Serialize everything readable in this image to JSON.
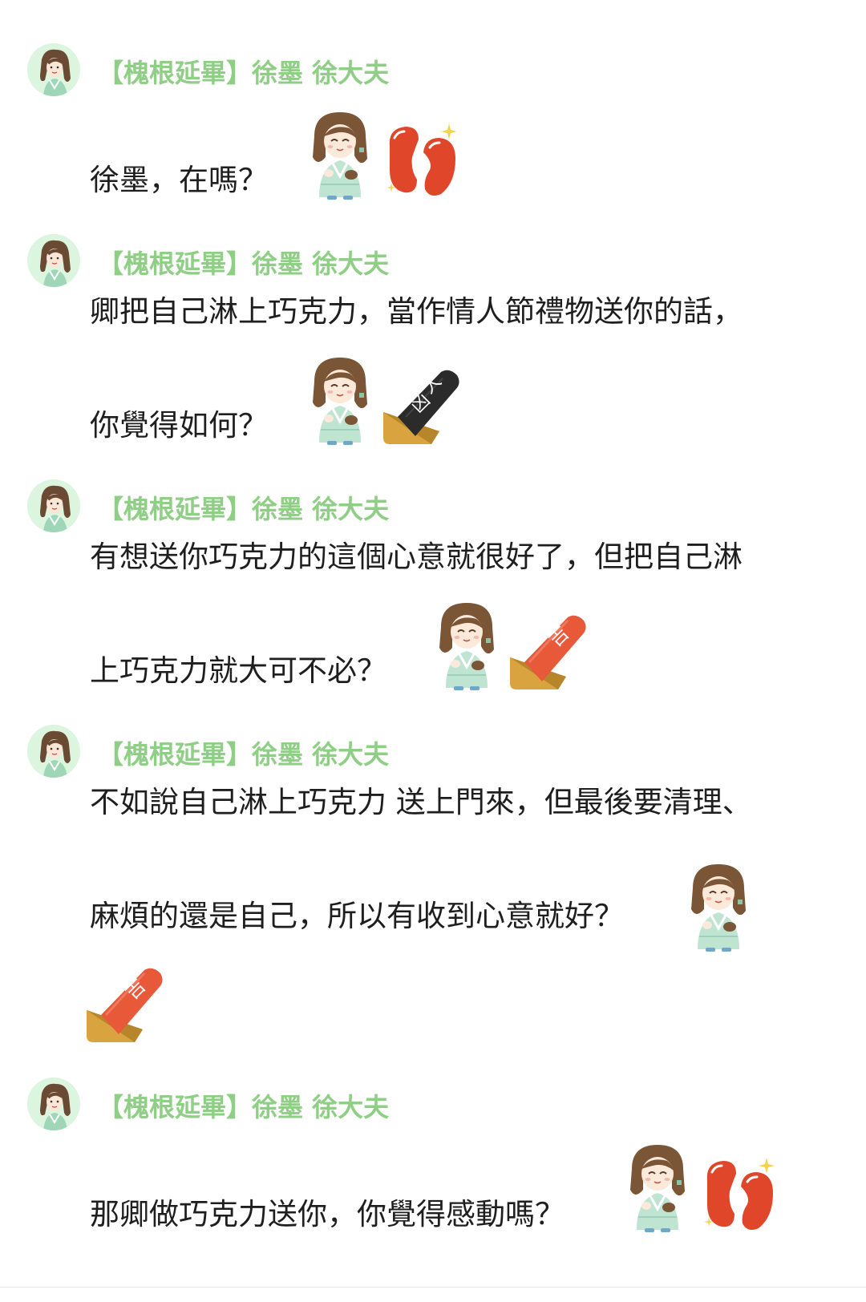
{
  "messages": [
    {
      "sender": "【槐根延畢】徐墨 徐大夫",
      "lines": [
        "徐墨，在嗎？"
      ],
      "stickers": [
        "chibi-girl",
        "red-beans"
      ]
    },
    {
      "sender": "【槐根延畢】徐墨 徐大夫",
      "lines": [
        "卿把自己淋上巧克力，當作情人節禮物送你的話，",
        "你覺得如何？"
      ],
      "stickers": [
        "chibi-girl",
        "fortune-stick-大凶"
      ]
    },
    {
      "sender": "【槐根延畢】徐墨 徐大夫",
      "lines": [
        "有想送你巧克力的這個心意就很好了，但把自己淋",
        "上巧克力就大可不必？"
      ],
      "stickers": [
        "chibi-girl",
        "fortune-stick-吉"
      ]
    },
    {
      "sender": "【槐根延畢】徐墨 徐大夫",
      "lines": [
        "不如說自己淋上巧克力 送上門來，但最後要清理、",
        "麻煩的還是自己，所以有收到心意就好？"
      ],
      "stickers": [
        "chibi-girl",
        "fortune-stick-吉"
      ]
    },
    {
      "sender": "【槐根延畢】徐墨 徐大夫",
      "lines": [
        "那卿做巧克力送你，你覺得感動嗎？"
      ],
      "stickers": [
        "chibi-girl",
        "red-beans"
      ]
    }
  ],
  "fortune_labels": {
    "daxiong": "大凶",
    "ji": "吉"
  },
  "colors": {
    "sender_name": "#8fcf85",
    "text": "#1e1e1e",
    "avatar_bg": "#dcf5df",
    "bean_red": "#e0472a",
    "stick_black": "#2b2b2b",
    "stick_orange": "#e8593a",
    "stick_holder": "#d9a33f"
  }
}
